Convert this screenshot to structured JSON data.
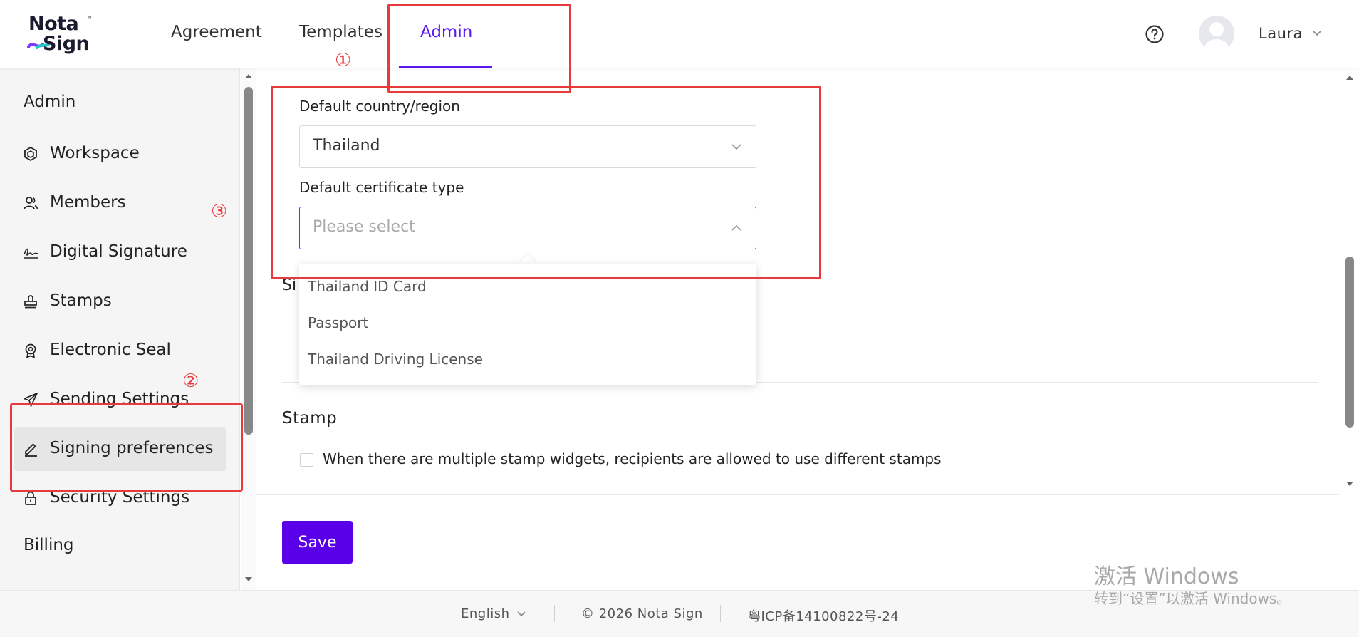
{
  "header": {
    "logo_line1": "Nota",
    "logo_line2": "Sign",
    "logo_tm": "™",
    "nav": [
      {
        "label": "Agreement"
      },
      {
        "label": "Templates"
      },
      {
        "label": "Admin",
        "active": true
      }
    ],
    "user_name": "Laura"
  },
  "sidebar": {
    "section_admin": "Admin",
    "items": [
      {
        "label": "Workspace",
        "icon": "workspace-icon"
      },
      {
        "label": "Members",
        "icon": "members-icon"
      },
      {
        "label": "Digital Signature",
        "icon": "signature-icon"
      },
      {
        "label": "Stamps",
        "icon": "stamp-icon"
      },
      {
        "label": "Electronic Seal",
        "icon": "seal-icon"
      },
      {
        "label": "Sending Settings",
        "icon": "send-icon"
      },
      {
        "label": "Signing preferences",
        "icon": "pen-icon",
        "active": true
      },
      {
        "label": "Security Settings",
        "icon": "lock-icon"
      }
    ],
    "section_billing": "Billing"
  },
  "main": {
    "country_label": "Default country/region",
    "country_value": "Thailand",
    "cert_label": "Default certificate type",
    "cert_placeholder": "Please select",
    "cert_options": [
      "Thailand ID Card",
      "Passport",
      "Thailand Driving License"
    ],
    "partial_heading": "Si",
    "stamp_section": "Stamp",
    "stamp_option": "When there are multiple stamp widgets, recipients are allowed to use different stamps",
    "save_label": "Save"
  },
  "footer": {
    "language": "English",
    "copyright": "© 2026 Nota Sign",
    "icp": "粤ICP备14100822号-24"
  },
  "watermark": {
    "line1": "激活 Windows",
    "line2": "转到“设置”以激活 Windows。"
  },
  "annotations": [
    "①",
    "②",
    "③"
  ],
  "colors": {
    "accent": "#5a17ee",
    "primary_button": "#5a00e8",
    "annotation_red": "#e83a3a",
    "sidebar_bg": "#f5f5f5"
  }
}
